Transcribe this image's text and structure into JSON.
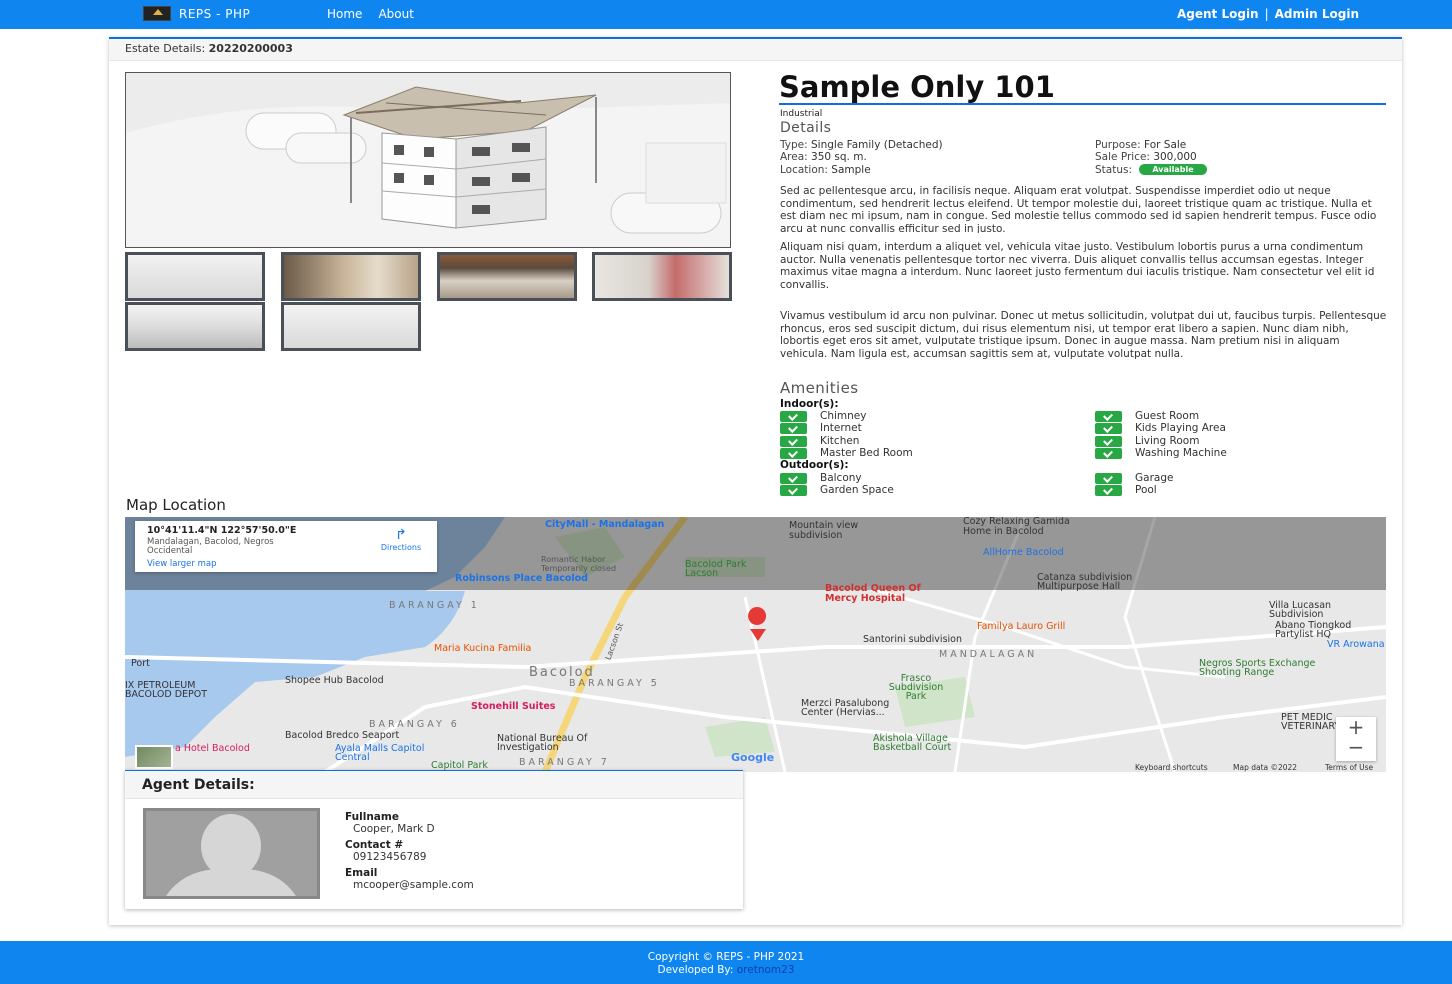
{
  "nav": {
    "brand": "REPS - PHP",
    "links": [
      "Home",
      "About"
    ],
    "agent_login": "Agent Login",
    "separator": "|",
    "admin_login": "Admin Login"
  },
  "estate": {
    "header_label": "Estate Details:",
    "code": "20220200003",
    "title": "Sample Only 101",
    "category": "Industrial",
    "details_heading": "Details",
    "details": {
      "type_label": "Type:",
      "type": "Single Family (Detached)",
      "area_label": "Area:",
      "area": "350 sq. m.",
      "location_label": "Location:",
      "location": "Sample",
      "purpose_label": "Purpose:",
      "purpose": "For Sale",
      "price_label": "Sale Price:",
      "price": "300,000",
      "status_label": "Status:",
      "status": "Available"
    },
    "paragraphs": [
      "Sed ac pellentesque arcu, in facilisis neque. Aliquam erat volutpat. Suspendisse imperdiet odio ut neque condimentum, sed hendrerit lectus eleifend. Ut tempor molestie dui, laoreet tristique quam ac tristique. Nulla et est diam nec mi ipsum, nam in congue. Sed molestie tellus commodo sed id sapien hendrerit tempus. Fusce odio arcu at nunc convallis efficitur sed in justo.",
      "Aliquam nisi quam, interdum a aliquet vel, vehicula vitae justo. Vestibulum lobortis purus a urna condimentum auctor. Nulla venenatis pellentesque tortor nec viverra. Duis aliquet convallis tellus accumsan egestas. Integer maximus vitae magna a interdum. Nunc laoreet justo fermentum dui iaculis tristique. Nam consectetur vel elit id convallis.",
      "Vivamus vestibulum id arcu non pulvinar. Donec ut metus sollicitudin, volutpat dui ut, faucibus turpis. Pellentesque rhoncus, eros sed suscipit dictum, dui risus elementum nisi, ut tempor erat libero a sapien. Nunc diam nibh, lobortis eget eros sit amet, vulputate tristique ipsum. Donec in augue massa. Nam pretium nisi in aliquam vehicula. Nam ligula est, accumsan sagittis sem at, vulputate volutpat nulla."
    ],
    "amenities_heading": "Amenities",
    "indoor_label": "Indoor(s):",
    "indoor": [
      "Chimney",
      "Guest Room",
      "Internet",
      "Kids Playing Area",
      "Kitchen",
      "Living Room",
      "Master Bed Room",
      "Washing Machine"
    ],
    "outdoor_label": "Outdoor(s):",
    "outdoor": [
      "Balcony",
      "Garage",
      "Garden Space",
      "Pool"
    ]
  },
  "map": {
    "heading": "Map Location",
    "coords": "10°41'11.4\"N 122°57'50.0\"E",
    "address": "Mandalagan, Bacolod, Negros Occidental",
    "larger_map": "View larger map",
    "directions": "Directions",
    "labels": [
      "CityMall - Mandalagan",
      "Mountain view subdivision",
      "Cozy Relaxing Gamida Home in Bacolod",
      "Romantic Habor Temporarily closed",
      "Bacolod Park Lacson",
      "AllHome Bacolod",
      "Robinsons Place Bacolod",
      "Bacolod Queen Of Mercy Hospital",
      "Catanza subdivision Multipurpose Hall",
      "BARANGAY 1",
      "Familya Lauro Grill",
      "Villa Lucasan Subdivision",
      "Abano Tiongkod Partylist HQ",
      "VR Arowana Gar",
      "Santorini subdivision",
      "Maria Kucina Familia",
      "MANDALAGAN",
      "Port",
      "Bacolod",
      "BARANGAY 5",
      "Negros Sports Exchange Shooting Range",
      "IX PETROLEUM BACOLOD DEPOT",
      "Shopee Hub Bacolod",
      "Frasco Subdivision Park",
      "Stonehill Suites",
      "Merzci Pasalubong Center (Hervias...",
      "BARANGAY 6",
      "Bacolod Bredco Seaport",
      "National Bureau Of Investigation",
      "Akishola Village Basketball Court",
      "PET MEDIC VETERINARY C",
      "Ayala Malls Capitol Central",
      "a Hotel Bacolod",
      "Capitol Park",
      "BARANGAY 7",
      "Lacson St",
      "Google",
      "Keyboard shortcuts",
      "Map data ©2022",
      "Terms of Use"
    ],
    "zoom_in": "+",
    "zoom_out": "−"
  },
  "agent": {
    "heading": "Agent Details:",
    "fullname_label": "Fullname",
    "fullname": "Cooper, Mark D",
    "contact_label": "Contact #",
    "contact": "09123456789",
    "email_label": "Email",
    "email": "mcooper@sample.com"
  },
  "footer": {
    "copyright": "Copyright © REPS - PHP 2021",
    "developed_by_label": "Developed By:",
    "developer": "oretnom23"
  }
}
